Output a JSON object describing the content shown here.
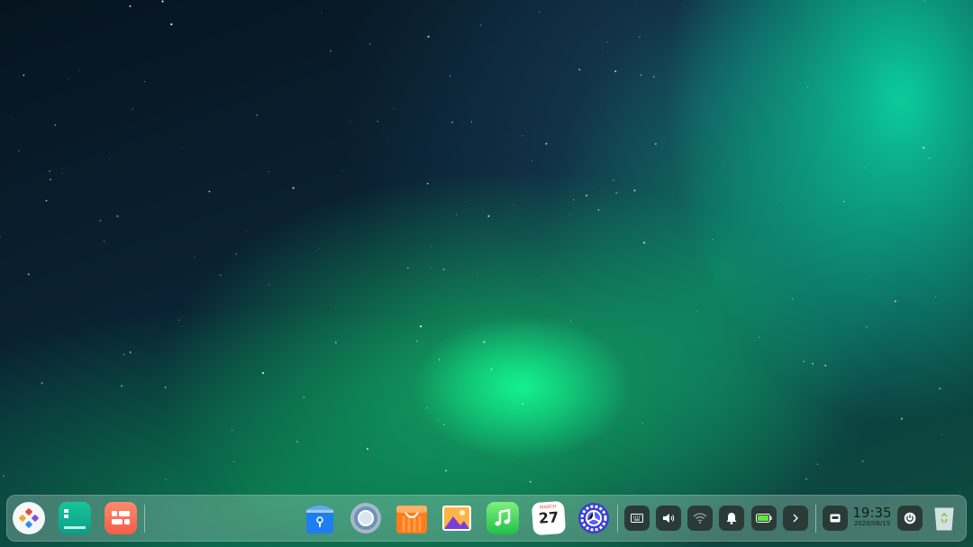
{
  "wallpaper": {
    "name": "aurora"
  },
  "dock": {
    "launcher": {
      "icon": "launcher-icon"
    },
    "apps": [
      {
        "name": "file-manager",
        "icon": "file-manager-icon"
      },
      {
        "name": "multitasking-view",
        "icon": "multitask-icon"
      },
      {
        "name": "browser-guard",
        "icon": "lock-bag-icon"
      },
      {
        "name": "browser",
        "icon": "globe-icon"
      },
      {
        "name": "app-store",
        "icon": "shopping-bag-icon"
      },
      {
        "name": "image-viewer",
        "icon": "picture-icon"
      },
      {
        "name": "music",
        "icon": "music-note-icon"
      },
      {
        "name": "calendar",
        "icon": "calendar-icon",
        "month": "MARCH",
        "day": "27"
      },
      {
        "name": "control-center",
        "icon": "gear-icon"
      }
    ],
    "tray": [
      {
        "name": "keyboard",
        "icon": "keyboard-icon"
      },
      {
        "name": "sound",
        "icon": "speaker-icon"
      },
      {
        "name": "network",
        "icon": "wifi-icon"
      },
      {
        "name": "notifications",
        "icon": "bell-icon"
      },
      {
        "name": "battery",
        "icon": "battery-icon"
      },
      {
        "name": "expand",
        "icon": "chevron-right-icon"
      }
    ],
    "clock": {
      "time": "19:35",
      "date": "2020/08/15"
    },
    "power": {
      "icon": "power-icon"
    },
    "trash": {
      "icon": "trash-icon"
    }
  }
}
